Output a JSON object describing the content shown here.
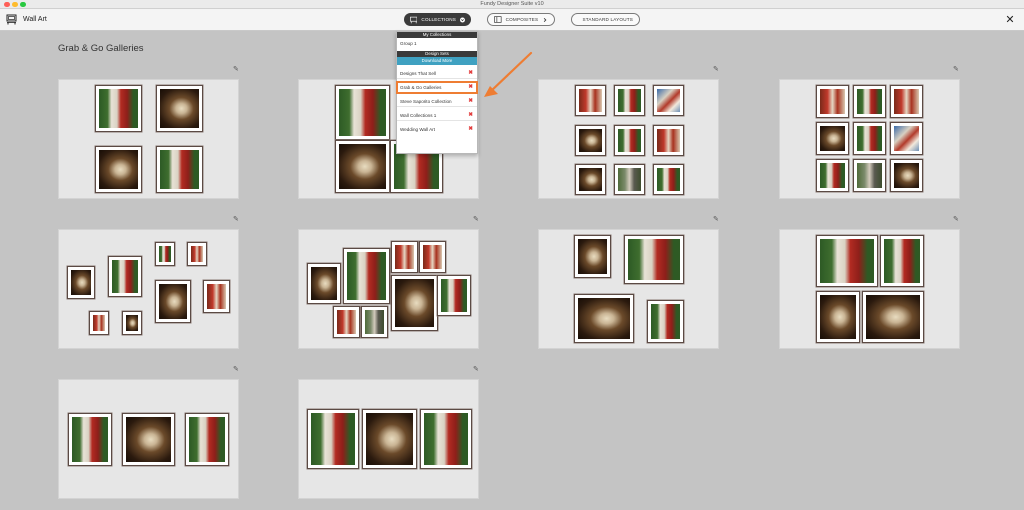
{
  "window": {
    "title": "Fundy Designer Suite v10",
    "traffic_colors": {
      "close": "#fe5f57",
      "minimize": "#febc2e",
      "zoom": "#28c840"
    }
  },
  "toolbar": {
    "module_label": "Wall Art",
    "collections_label": "COLLECTIONS",
    "composites_label": "COMPOSITES",
    "standard_layouts_label": "STANDARD LAYOUTS",
    "close_glyph": "✕"
  },
  "main": {
    "section_title": "Grab & Go Galleries",
    "edit_glyph": "✎"
  },
  "dropdown": {
    "my_collections_header": "My Collections",
    "my_collections": [
      "Group 1"
    ],
    "design_sets_header": "Design Sets",
    "download_more_label": "Download More",
    "design_sets": [
      {
        "label": "Designs That Sell",
        "selected": false
      },
      {
        "label": "Grab & Go Galleries",
        "selected": true
      },
      {
        "label": "Steve Saporito Collection",
        "selected": false
      },
      {
        "label": "Wall Collections 1",
        "selected": false
      },
      {
        "label": "Wedding Wall Art",
        "selected": false
      }
    ],
    "delete_glyph": "✖"
  },
  "colors": {
    "accent_blue": "#3fa1c1",
    "highlight_orange": "#ee7d33",
    "delete_red": "#e23b3b"
  },
  "gallery_count": 10
}
